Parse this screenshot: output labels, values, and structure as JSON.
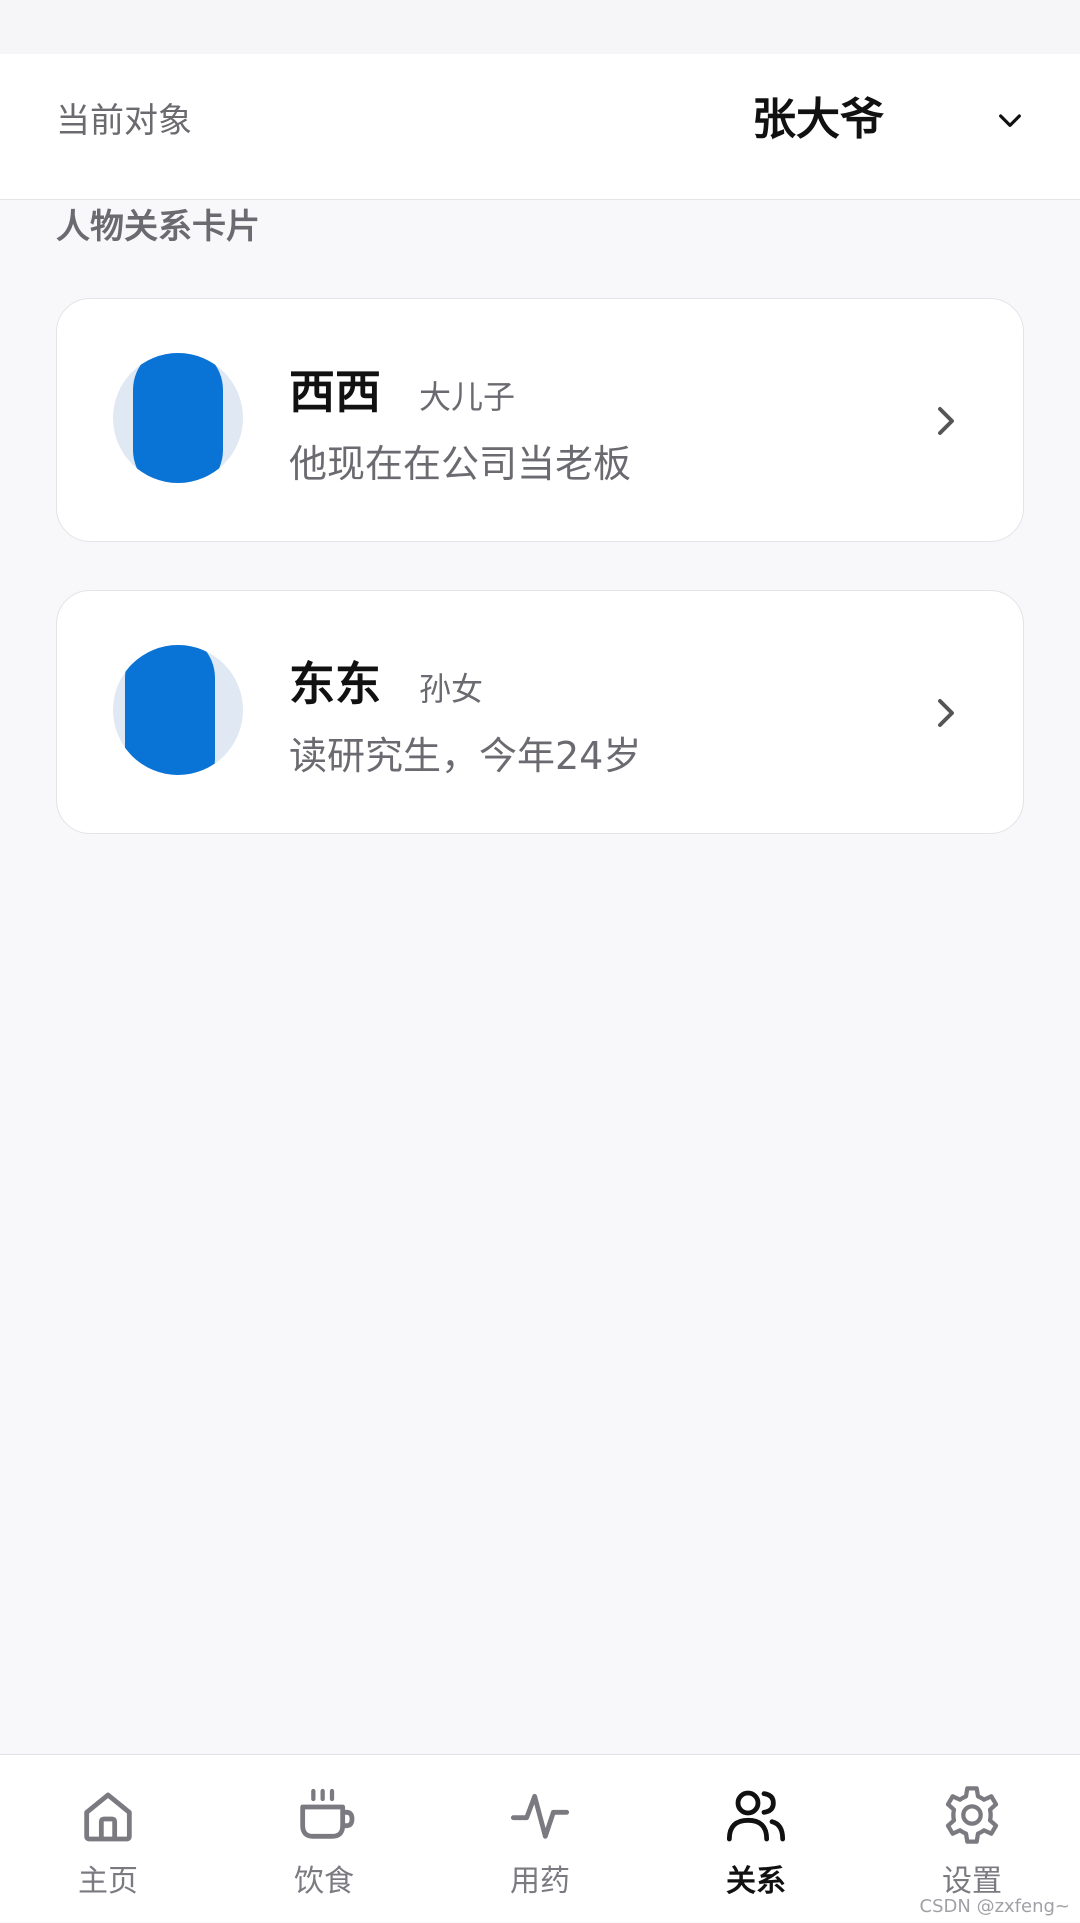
{
  "header": {
    "label": "当前对象",
    "current_person": "张大爷",
    "dropdown_icon": "chevron-down-icon"
  },
  "section": {
    "title": "人物关系卡片"
  },
  "cards": [
    {
      "name": "西西",
      "relation": "大儿子",
      "description": "他现在在公司当老板",
      "icon": "chevron-right-icon"
    },
    {
      "name": "东东",
      "relation": "孙女",
      "description": "读研究生，今年24岁",
      "icon": "chevron-right-icon"
    }
  ],
  "tabbar": {
    "items": [
      {
        "label": "主页",
        "icon": "home-icon",
        "active": false
      },
      {
        "label": "饮食",
        "icon": "cup-icon",
        "active": false
      },
      {
        "label": "用药",
        "icon": "pulse-icon",
        "active": false
      },
      {
        "label": "关系",
        "icon": "users-icon",
        "active": true
      },
      {
        "label": "设置",
        "icon": "gear-icon",
        "active": false
      }
    ]
  },
  "watermark": "CSDN @zxfeng~",
  "colors": {
    "avatar_overlay": "#0a73d6",
    "active_tab": "#111111",
    "inactive_tab": "#7a7a80"
  }
}
